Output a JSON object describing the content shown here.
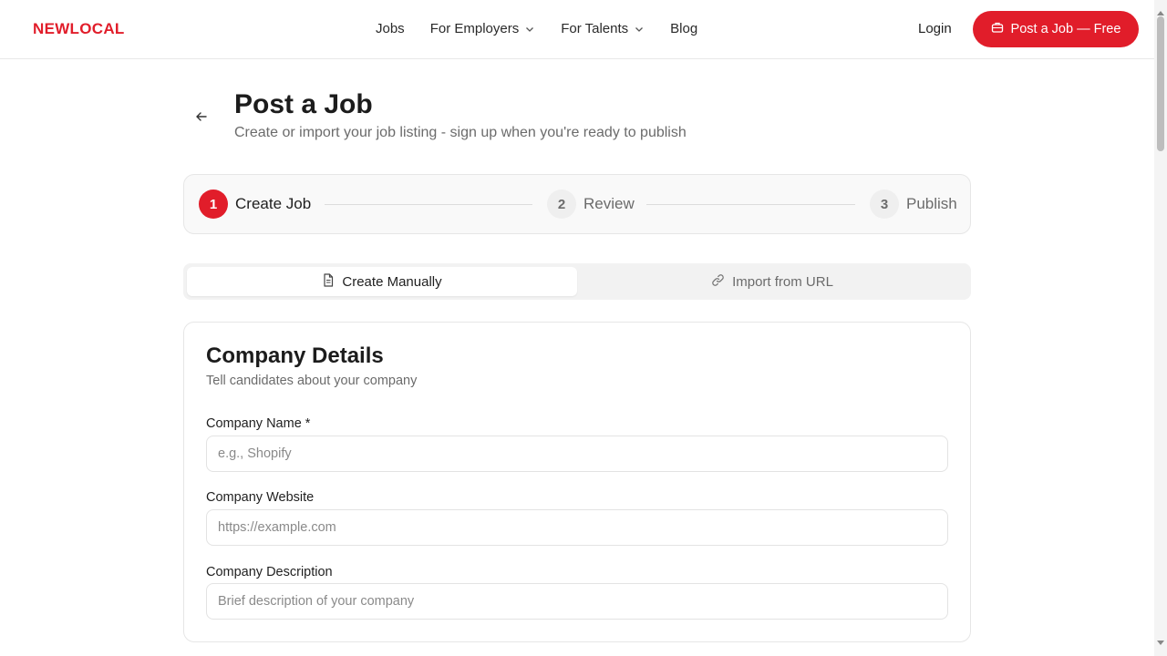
{
  "header": {
    "logo": "NEWLOCAL",
    "nav": [
      {
        "label": "Jobs",
        "dropdown": false
      },
      {
        "label": "For Employers",
        "dropdown": true
      },
      {
        "label": "For Talents",
        "dropdown": true
      },
      {
        "label": "Blog",
        "dropdown": false
      }
    ],
    "login_label": "Login",
    "post_job_label": "Post a Job — Free"
  },
  "page": {
    "title": "Post a Job",
    "subtitle": "Create or import your job listing - sign up when you're ready to publish"
  },
  "stepper": {
    "steps": [
      {
        "number": "1",
        "label": "Create Job",
        "state": "active"
      },
      {
        "number": "2",
        "label": "Review",
        "state": "inactive"
      },
      {
        "number": "3",
        "label": "Publish",
        "state": "inactive"
      }
    ]
  },
  "tabs": [
    {
      "label": "Create Manually",
      "icon": "document-icon",
      "active": true
    },
    {
      "label": "Import from URL",
      "icon": "link-icon",
      "active": false
    }
  ],
  "company_details": {
    "title": "Company Details",
    "subtitle": "Tell candidates about your company",
    "fields": [
      {
        "label": "Company Name *",
        "value": "",
        "placeholder": "e.g., Shopify"
      },
      {
        "label": "Company Website",
        "value": "",
        "placeholder": "https://example.com"
      },
      {
        "label": "Company Description",
        "value": "",
        "placeholder": "Brief description of your company"
      }
    ]
  },
  "colors": {
    "brand": "#e11d2a",
    "text_muted": "#6b6b6b",
    "border": "#e6e6e6"
  }
}
